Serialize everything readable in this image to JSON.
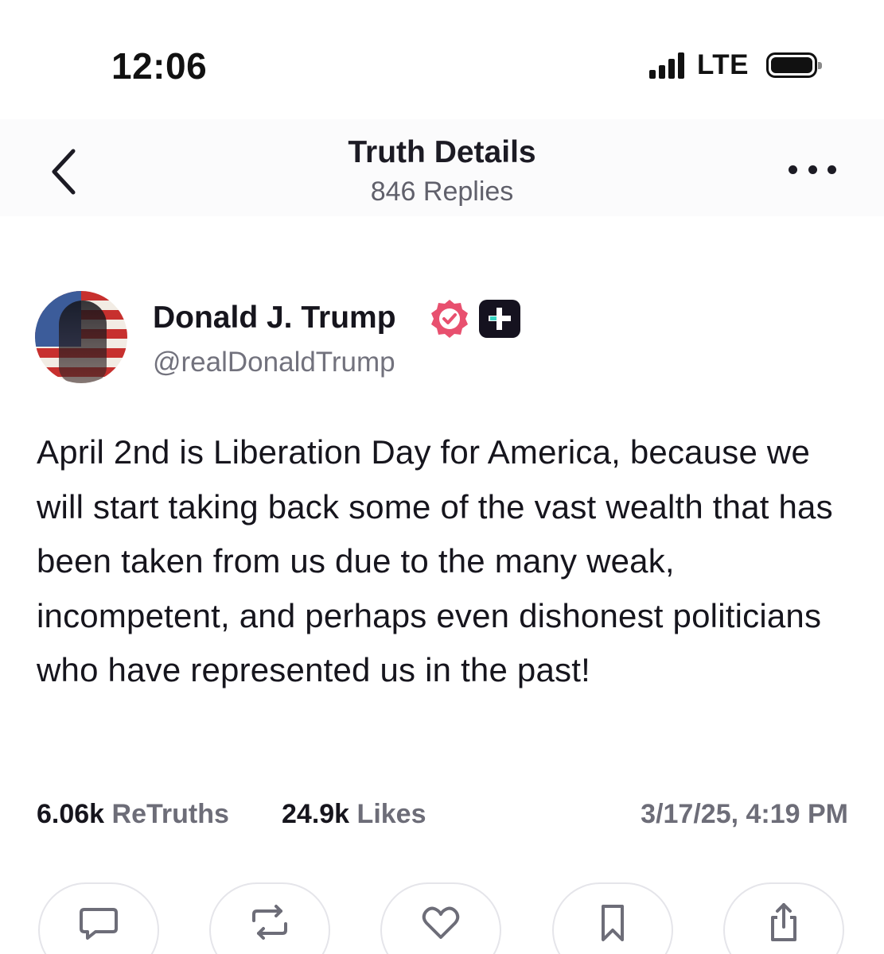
{
  "status_bar": {
    "time": "12:06",
    "network": "LTE",
    "icons": [
      "signal-icon",
      "battery-icon"
    ]
  },
  "header": {
    "title": "Truth Details",
    "subtitle": "846 Replies",
    "back_icon": "chevron-left-icon",
    "more_icon": "more-horizontal-icon"
  },
  "post": {
    "author": {
      "name": "Donald J. Trump",
      "handle": "@realDonaldTrump",
      "verified_icon": "verified-badge-icon",
      "plus_icon": "plus-badge-icon"
    },
    "text": "April 2nd is Liberation Day for America, because we will start taking back some of the vast wealth that has been taken from us due to the many weak, incompetent, and perhaps even dishonest politicians who have represented us in the past!",
    "stats": {
      "retruths_count": "6.06k",
      "retruths_label": "ReTruths",
      "likes_count": "24.9k",
      "likes_label": "Likes"
    },
    "timestamp": "3/17/25, 4:19 PM"
  },
  "actions": [
    {
      "icon": "reply-icon"
    },
    {
      "icon": "retruth-icon"
    },
    {
      "icon": "like-icon"
    },
    {
      "icon": "bookmark-icon"
    },
    {
      "icon": "share-icon"
    }
  ],
  "colors": {
    "text_primary": "#16151d",
    "text_secondary": "#6d6d78",
    "verified_accent": "#e8506f",
    "plus_badge_bg": "#15121f",
    "plus_badge_mark": "#36d3c1",
    "action_border": "#e5e5ea"
  }
}
